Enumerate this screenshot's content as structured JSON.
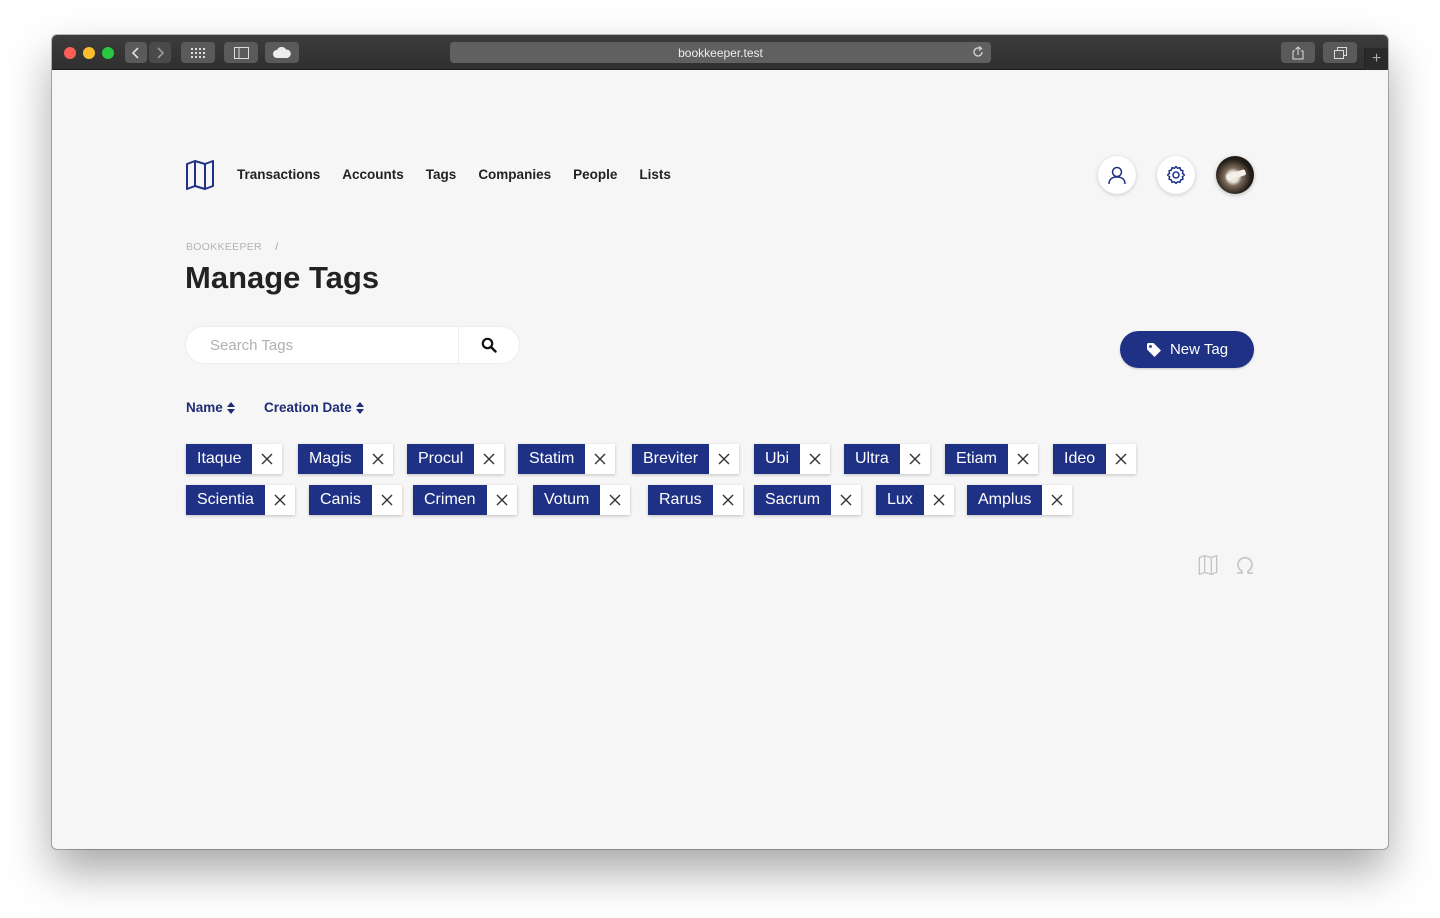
{
  "browser": {
    "url": "bookkeeper.test"
  },
  "nav": {
    "items": [
      "Transactions",
      "Accounts",
      "Tags",
      "Companies",
      "People",
      "Lists"
    ]
  },
  "breadcrumb": {
    "root": "BOOKKEEPER",
    "separator": "/"
  },
  "page": {
    "title": "Manage Tags"
  },
  "search": {
    "placeholder": "Search Tags",
    "value": ""
  },
  "actions": {
    "new_tag_label": "New Tag"
  },
  "sort": {
    "name_label": "Name",
    "date_label": "Creation Date"
  },
  "tags": {
    "row1": [
      "Itaque",
      "Magis",
      "Procul",
      "Statim",
      "Breviter",
      "Ubi",
      "Ultra",
      "Etiam",
      "Ideo"
    ],
    "row2": [
      "Scientia",
      "Canis",
      "Crimen",
      "Votum",
      "Rarus",
      "Sacrum",
      "Lux",
      "Amplus"
    ]
  },
  "colors": {
    "accent": "#1f3184",
    "background": "#f6f6f6"
  },
  "icons": {
    "logo": "map-icon",
    "account": "user-icon",
    "settings": "gear-icon",
    "search": "search-icon",
    "tag": "tag-icon",
    "remove": "close-icon",
    "sort": "sort-icon",
    "footer": [
      "map-icon",
      "omega-icon"
    ]
  }
}
